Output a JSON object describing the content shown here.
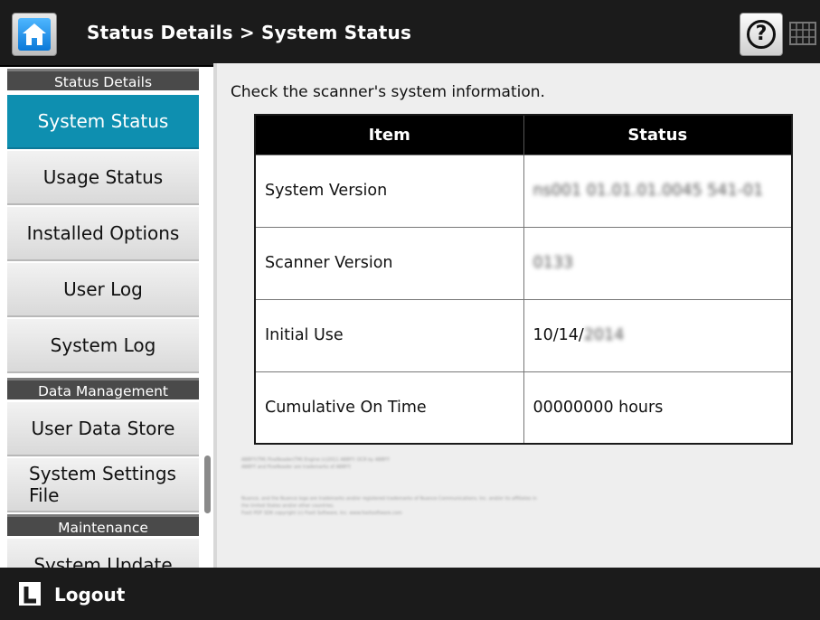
{
  "header": {
    "title": "Status Details > System Status",
    "home_icon": "home-icon",
    "help_icon": "help-icon",
    "help_glyph": "?",
    "keyboard_icon": "keyboard-icon"
  },
  "sidebar": {
    "sections": [
      {
        "label": "Status Details"
      },
      {
        "label": "Data Management"
      },
      {
        "label": "Maintenance"
      }
    ],
    "items": [
      {
        "label": "System Status",
        "active": true
      },
      {
        "label": "Usage Status"
      },
      {
        "label": "Installed Options"
      },
      {
        "label": "User Log"
      },
      {
        "label": "System Log"
      },
      {
        "label": "User Data Store"
      },
      {
        "label": "System Settings File"
      },
      {
        "label": "System Update"
      }
    ]
  },
  "main": {
    "intro": "Check the scanner's system information.",
    "table": {
      "headers": [
        "Item",
        "Status"
      ],
      "rows": [
        {
          "item": "System Version",
          "status": "ns001 01.01.01.0045 541-01"
        },
        {
          "item": "Scanner Version",
          "status": "0133"
        },
        {
          "item": "Initial Use",
          "status_prefix": "10/14/",
          "status_blur": "2014"
        },
        {
          "item": "Cumulative On Time",
          "status": "00000000 hours"
        }
      ]
    },
    "footnotes": [
      "ABBYY(TM) FineReader(TM) Engine (c)2011 ABBYY. OCR by ABBYY",
      "ABBYY and FineReader are trademarks of ABBYY.",
      "Nuance, and the Nuance logo are trademarks and/or registered trademarks of Nuance Communications, Inc. and/or its affiliates in",
      "the United States and/or other countries.",
      "Foxit PDF SDK copyright (c) Foxit Software, Inc. www.foxitsoftware.com"
    ]
  },
  "footer": {
    "logout_label": "Logout",
    "logout_icon": "logout-icon"
  },
  "colors": {
    "active_item": "#0e8fb0",
    "header_bg": "#1b1b1b",
    "section_bg": "#4a4a4a"
  }
}
